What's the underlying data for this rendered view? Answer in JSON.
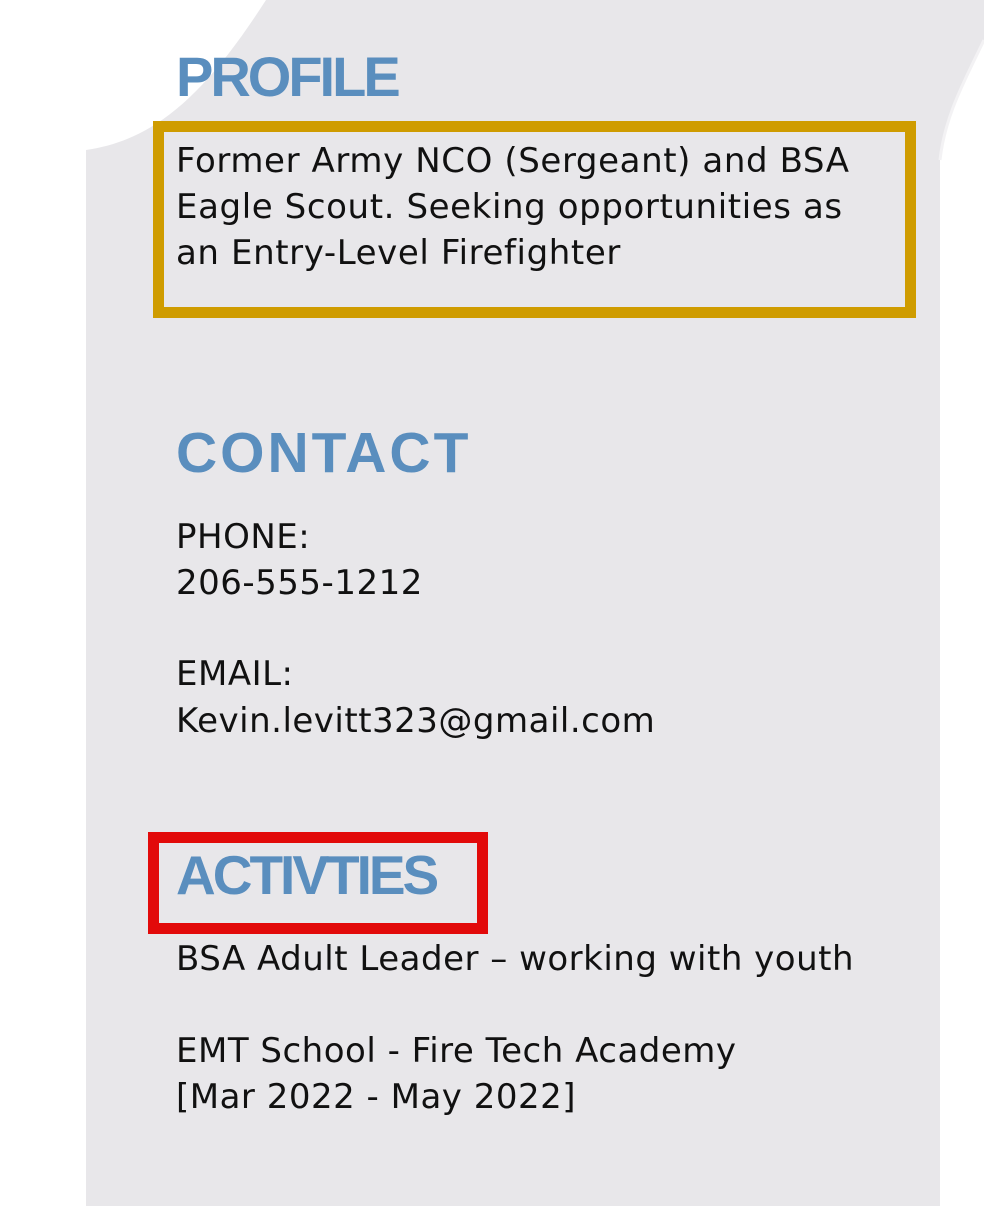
{
  "sections": {
    "profile": {
      "heading": "PROFILE",
      "lines": [
        "Former Army NCO (Sergeant) and BSA",
        "Eagle Scout. Seeking opportunities as",
        "an Entry-Level Firefighter"
      ]
    },
    "contact": {
      "heading": "CONTACT",
      "phone_label": "PHONE:",
      "phone_value": "206-555-1212",
      "email_label": "EMAIL:",
      "email_value": "Kevin.levitt323@gmail.com"
    },
    "activities": {
      "heading": "ACTIVTIES",
      "items": [
        {
          "title": "BSA Adult Leader – working with youth"
        },
        {
          "title": "EMT School - Fire Tech Academy",
          "dates": "[Mar 2022 - May 2022]"
        }
      ]
    }
  },
  "colors": {
    "heading": "#5a8ebe",
    "panel_background": "#e8e7ea",
    "profile_highlight_border": "#cf9c00",
    "activities_highlight_border": "#e20a0a"
  }
}
